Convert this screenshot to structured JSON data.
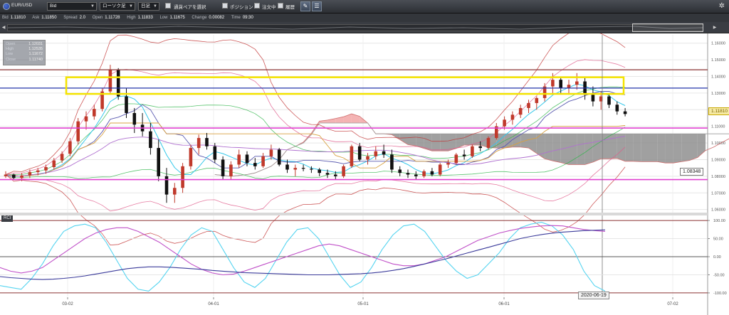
{
  "toolbar": {
    "symbol": "EUR/USD",
    "price_type": "Bid",
    "chart_type": "ローソク足",
    "timeframe": "日足",
    "pair_select_label": "通貨ペアを選択",
    "position_label": "ポジション",
    "orders_label": "注文中",
    "history_label": "履歴"
  },
  "quote": {
    "bid_label": "Bid",
    "bid": "1.11810",
    "ask_label": "Ask",
    "ask": "1.11850",
    "spread_label": "Spread",
    "spread": "2.0",
    "open_label": "Open",
    "open": "1.11728",
    "high_label": "High",
    "high": "1.11833",
    "low_label": "Low",
    "low": "1.11675",
    "change_label": "Change",
    "change": "0.00082",
    "time_label": "Time",
    "time": "09:30"
  },
  "ohlc_box": {
    "open_label": "Open",
    "open": "1.12031",
    "high_label": "High",
    "high": "1.12535",
    "low_label": "Low",
    "low": "1.11672",
    "close_label": "Close",
    "close": "1.11740"
  },
  "current_price_tag": "1.11810",
  "level_tag": "1.08348",
  "date_tag": "2020-06-19",
  "rci_label": "RCI",
  "colors": {
    "up_candle": "#c0392b",
    "down_candle": "#111111",
    "highlight_box": "#f5e400",
    "support_line": "#e040d0",
    "resistance_line": "#2233aa",
    "kumo_bearish": "#8f8f8f",
    "kumo_bullish": "#f2a6a6",
    "rci_short": "#55d4f0",
    "rci_mid": "#c050c8",
    "rci_long": "#3a3a9a"
  },
  "chart_data": [
    {
      "type": "candlestick",
      "symbol": "EUR/USD",
      "timeframe": "daily",
      "x_ticks": [
        "03-02",
        "04-01",
        "05-01",
        "06-01",
        "07-02"
      ],
      "y_ticks": [
        "1.16000",
        "1.15000",
        "1.14000",
        "1.13000",
        "1.12000",
        "1.11000",
        "1.10000",
        "1.09000",
        "1.08000",
        "1.07000",
        "1.06000"
      ],
      "ylim": [
        1.059,
        1.165
      ],
      "series": [
        {
          "name": "candles",
          "ohlc": [
            [
              1.08,
              1.083,
              1.079,
              1.081
            ],
            [
              1.081,
              1.0815,
              1.078,
              1.079
            ],
            [
              1.079,
              1.082,
              1.077,
              1.0805
            ],
            [
              1.0805,
              1.084,
              1.079,
              1.0825
            ],
            [
              1.0825,
              1.085,
              1.0805,
              1.0835
            ],
            [
              1.0835,
              1.087,
              1.0815,
              1.0855
            ],
            [
              1.0855,
              1.091,
              1.084,
              1.0895
            ],
            [
              1.0895,
              1.095,
              1.088,
              1.0935
            ],
            [
              1.0935,
              1.103,
              1.092,
              1.101
            ],
            [
              1.101,
              1.115,
              1.099,
              1.113
            ],
            [
              1.113,
              1.119,
              1.108,
              1.116
            ],
            [
              1.116,
              1.123,
              1.114,
              1.1205
            ],
            [
              1.1205,
              1.133,
              1.119,
              1.131
            ],
            [
              1.131,
              1.147,
              1.129,
              1.144
            ],
            [
              1.144,
              1.145,
              1.126,
              1.128
            ],
            [
              1.128,
              1.133,
              1.115,
              1.118
            ],
            [
              1.118,
              1.121,
              1.106,
              1.111
            ],
            [
              1.111,
              1.118,
              1.104,
              1.107
            ],
            [
              1.107,
              1.112,
              1.093,
              1.097
            ],
            [
              1.097,
              1.102,
              1.077,
              1.08
            ],
            [
              1.08,
              1.085,
              1.064,
              1.069
            ],
            [
              1.069,
              1.076,
              1.064,
              1.073
            ],
            [
              1.073,
              1.088,
              1.07,
              1.086
            ],
            [
              1.086,
              1.099,
              1.084,
              1.097
            ],
            [
              1.097,
              1.105,
              1.093,
              1.103
            ],
            [
              1.103,
              1.106,
              1.096,
              1.098
            ],
            [
              1.098,
              1.1,
              1.088,
              1.09
            ],
            [
              1.09,
              1.092,
              1.078,
              1.08
            ],
            [
              1.08,
              1.089,
              1.078,
              1.087
            ],
            [
              1.087,
              1.096,
              1.085,
              1.093
            ],
            [
              1.093,
              1.095,
              1.086,
              1.088
            ],
            [
              1.088,
              1.091,
              1.084,
              1.086
            ],
            [
              1.086,
              1.094,
              1.085,
              1.092
            ],
            [
              1.092,
              1.099,
              1.09,
              1.096
            ],
            [
              1.096,
              1.097,
              1.086,
              1.087
            ],
            [
              1.087,
              1.09,
              1.082,
              1.084
            ],
            [
              1.084,
              1.087,
              1.08,
              1.085
            ],
            [
              1.085,
              1.087,
              1.083,
              1.0845
            ],
            [
              1.0845,
              1.086,
              1.082,
              1.084
            ],
            [
              1.084,
              1.085,
              1.08,
              1.082
            ],
            [
              1.082,
              1.084,
              1.079,
              1.081
            ],
            [
              1.081,
              1.083,
              1.078,
              1.08
            ],
            [
              1.08,
              1.087,
              1.079,
              1.086
            ],
            [
              1.086,
              1.099,
              1.085,
              1.098
            ],
            [
              1.098,
              1.1,
              1.089,
              1.09
            ],
            [
              1.09,
              1.094,
              1.087,
              1.092
            ],
            [
              1.092,
              1.098,
              1.09,
              1.095
            ],
            [
              1.095,
              1.099,
              1.091,
              1.093
            ],
            [
              1.093,
              1.096,
              1.082,
              1.084
            ],
            [
              1.084,
              1.086,
              1.08,
              1.082
            ],
            [
              1.082,
              1.084,
              1.079,
              1.081
            ],
            [
              1.081,
              1.083,
              1.078,
              1.08
            ],
            [
              1.08,
              1.084,
              1.079,
              1.083
            ],
            [
              1.083,
              1.085,
              1.08,
              1.081
            ],
            [
              1.081,
              1.088,
              1.08,
              1.087
            ],
            [
              1.087,
              1.09,
              1.085,
              1.088
            ],
            [
              1.088,
              1.094,
              1.087,
              1.093
            ],
            [
              1.093,
              1.096,
              1.09,
              1.092
            ],
            [
              1.092,
              1.099,
              1.091,
              1.098
            ],
            [
              1.098,
              1.101,
              1.095,
              1.097
            ],
            [
              1.097,
              1.104,
              1.096,
              1.103
            ],
            [
              1.103,
              1.112,
              1.102,
              1.11
            ],
            [
              1.11,
              1.116,
              1.108,
              1.114
            ],
            [
              1.114,
              1.119,
              1.111,
              1.117
            ],
            [
              1.117,
              1.123,
              1.115,
              1.121
            ],
            [
              1.121,
              1.126,
              1.118,
              1.124
            ],
            [
              1.124,
              1.128,
              1.12,
              1.127
            ],
            [
              1.127,
              1.136,
              1.125,
              1.134
            ],
            [
              1.134,
              1.142,
              1.13,
              1.138
            ],
            [
              1.138,
              1.14,
              1.13,
              1.133
            ],
            [
              1.133,
              1.138,
              1.129,
              1.135
            ],
            [
              1.135,
              1.142,
              1.132,
              1.137
            ],
            [
              1.137,
              1.139,
              1.126,
              1.129
            ],
            [
              1.129,
              1.134,
              1.122,
              1.125
            ],
            [
              1.125,
              1.131,
              1.12,
              1.128
            ],
            [
              1.128,
              1.13,
              1.121,
              1.123
            ],
            [
              1.123,
              1.125,
              1.117,
              1.119
            ],
            [
              1.119,
              1.121,
              1.116,
              1.1174
            ]
          ]
        }
      ],
      "horizontal_lines": [
        {
          "value": 1.144
        },
        {
          "value": 1.133
        },
        {
          "value": 1.109
        },
        {
          "value": 1.078
        }
      ],
      "highlight_zone": [
        1.1295,
        1.1395
      ]
    },
    {
      "type": "line",
      "indicator": "RCI",
      "y_ticks": [
        "100.00",
        "50.00",
        "0.00",
        "-50.00",
        "-100.00"
      ],
      "ylim": [
        -110,
        110
      ],
      "series": [
        {
          "values": [
            -80,
            -85,
            -90,
            -60,
            -20,
            30,
            70,
            85,
            90,
            80,
            40,
            -10,
            -60,
            -90,
            -95,
            -70,
            -30,
            20,
            60,
            80,
            70,
            20,
            -30,
            -70,
            -85,
            -60,
            -10,
            40,
            75,
            80,
            50,
            0,
            -50,
            -85,
            -70,
            -30,
            20,
            60,
            85,
            90,
            70,
            30,
            -10,
            -40,
            -60,
            -50,
            -20,
            10,
            50,
            80,
            90,
            95,
            85,
            60,
            20,
            -40,
            -80,
            -95
          ]
        },
        {
          "values": [
            -30,
            -40,
            -45,
            -40,
            -30,
            -10,
            10,
            30,
            50,
            65,
            75,
            80,
            80,
            70,
            55,
            40,
            20,
            0,
            -20,
            -35,
            -45,
            -50,
            -48,
            -40,
            -30,
            -20,
            -10,
            0,
            10,
            20,
            30,
            35,
            30,
            20,
            10,
            0,
            -10,
            -20,
            -25,
            -25,
            -20,
            -10,
            0,
            15,
            30,
            45,
            55,
            65,
            72,
            78,
            82,
            85,
            86,
            85,
            80,
            75,
            72,
            70
          ]
        },
        {
          "values": [
            -55,
            -58,
            -60,
            -62,
            -63,
            -62,
            -60,
            -57,
            -53,
            -48,
            -43,
            -38,
            -33,
            -30,
            -28,
            -28,
            -29,
            -31,
            -33,
            -35,
            -38,
            -40,
            -42,
            -44,
            -45,
            -46,
            -47,
            -48,
            -49,
            -50,
            -50,
            -50,
            -49,
            -48,
            -47,
            -45,
            -42,
            -38,
            -33,
            -27,
            -20,
            -13,
            -6,
            2,
            10,
            18,
            26,
            34,
            42,
            50,
            56,
            61,
            65,
            68,
            70,
            72,
            73,
            74
          ]
        }
      ]
    }
  ]
}
